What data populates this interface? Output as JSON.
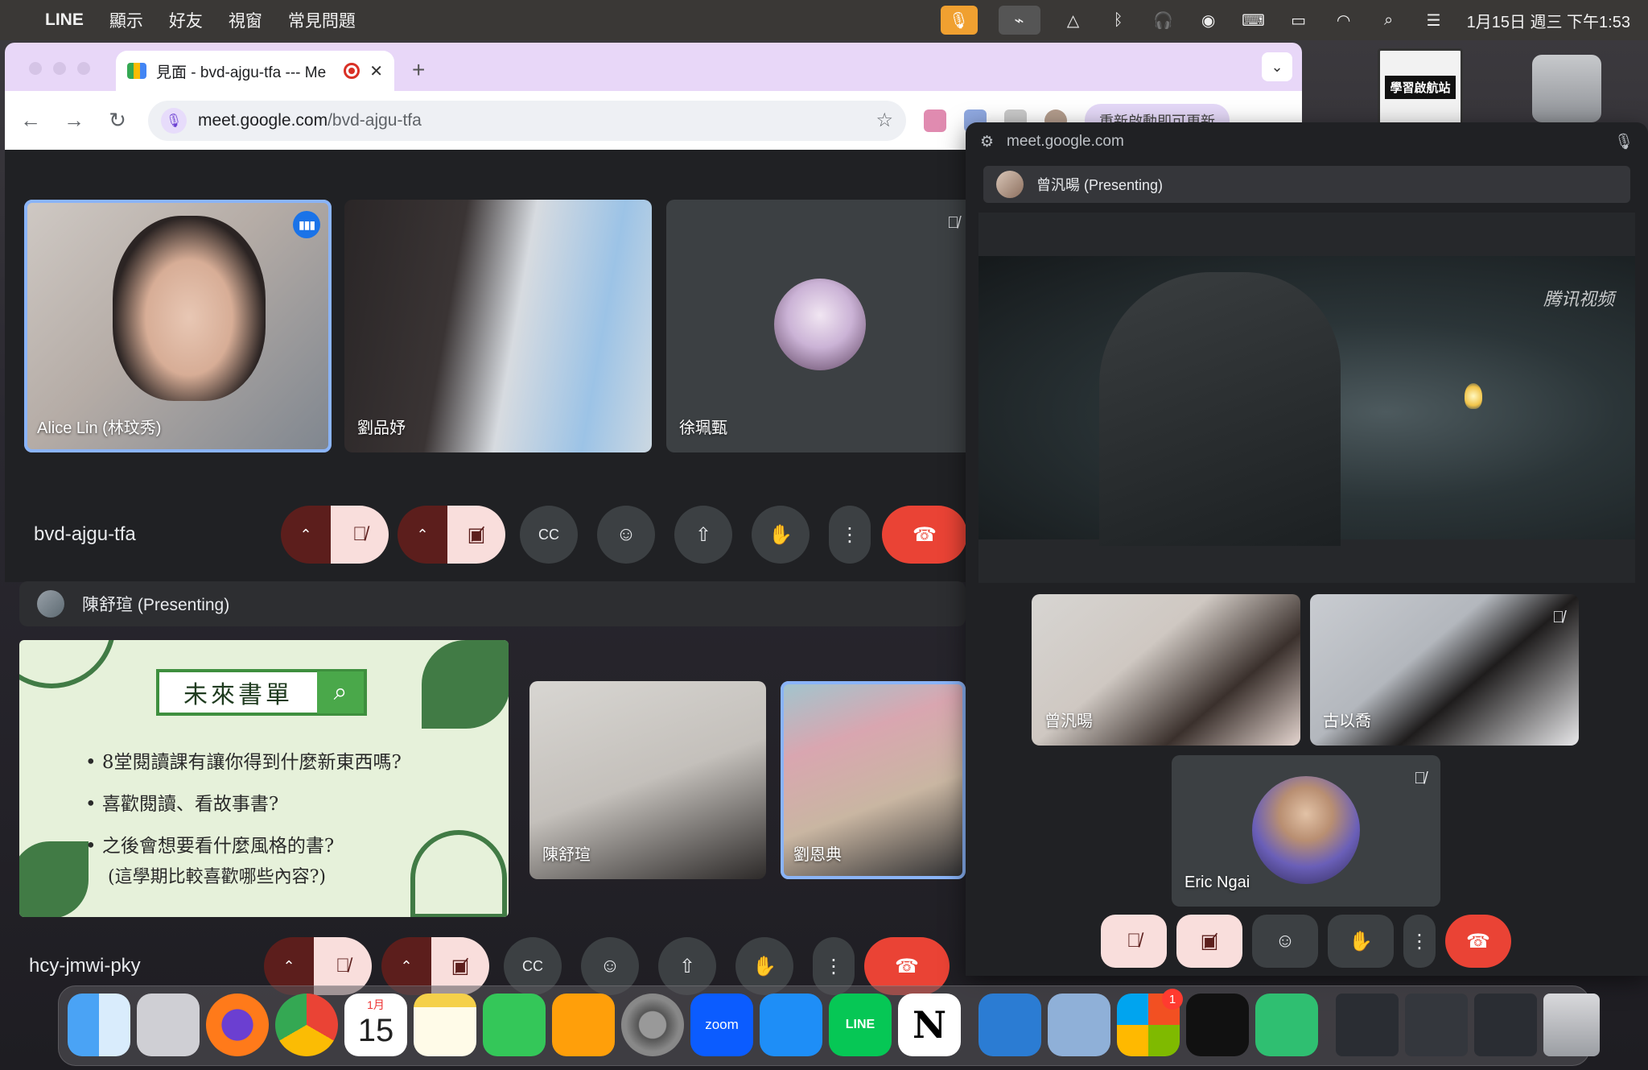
{
  "menubar": {
    "app": "LINE",
    "items": [
      "顯示",
      "好友",
      "視窗",
      "常見問題"
    ],
    "clock": "1月15日 週三 下午1:53"
  },
  "browser": {
    "tab_title": "見面 - bvd-ajgu-tfa --- Me",
    "url_host": "meet.google.com",
    "url_path": "/bvd-ajgu-tfa",
    "update_label": "重新啟動即可更新"
  },
  "meet1": {
    "meeting_code": "bvd-ajgu-tfa",
    "participants": [
      {
        "name": "Alice Lin (林玟秀)"
      },
      {
        "name": "劉品妤"
      },
      {
        "name": "徐珮甄"
      }
    ]
  },
  "meet2": {
    "presenting_label": "陳舒瑄 (Presenting)",
    "meeting_code": "hcy-jmwi-pky",
    "slide": {
      "search_text": "未來書單",
      "bullets": [
        "8堂閱讀課有讓你得到什麼新東西嗎?",
        "喜歡閱讀、看故事書?",
        "之後會想要看什麼風格的書?"
      ],
      "sub": "(這學期比較喜歡哪些內容?)"
    },
    "participants": [
      {
        "name": "陳舒瑄"
      },
      {
        "name": "劉恩典"
      }
    ]
  },
  "pip": {
    "origin": "meet.google.com",
    "presenting_label": "曾汎暘 (Presenting)",
    "watermark": "腾讯视频",
    "participants": [
      {
        "name": "曾汎暘"
      },
      {
        "name": "古以喬"
      },
      {
        "name": "Eric Ngai"
      }
    ]
  },
  "desktop": {
    "label_tile": "學習啟航站"
  },
  "dock": {
    "calendar_month": "1月",
    "calendar_day": "15",
    "zoom_label": "zoom",
    "line_label": "LINE",
    "badge_count": "1"
  },
  "colors": {
    "meet_bg": "#202124",
    "tile_bg": "#3c4043",
    "leave_red": "#ea4335",
    "muted_red": "#f9dedc",
    "active_blue": "#8ab4f8",
    "tab_strip": "#e8d7f8"
  },
  "icons": {
    "mic_off": "mic-off-icon",
    "camera_off": "camera-off-icon",
    "captions": "captions-icon",
    "emoji": "emoji-icon",
    "present": "present-icon",
    "raise_hand": "raise-hand-icon",
    "more": "more-vert-icon",
    "leave": "call-end-icon"
  }
}
